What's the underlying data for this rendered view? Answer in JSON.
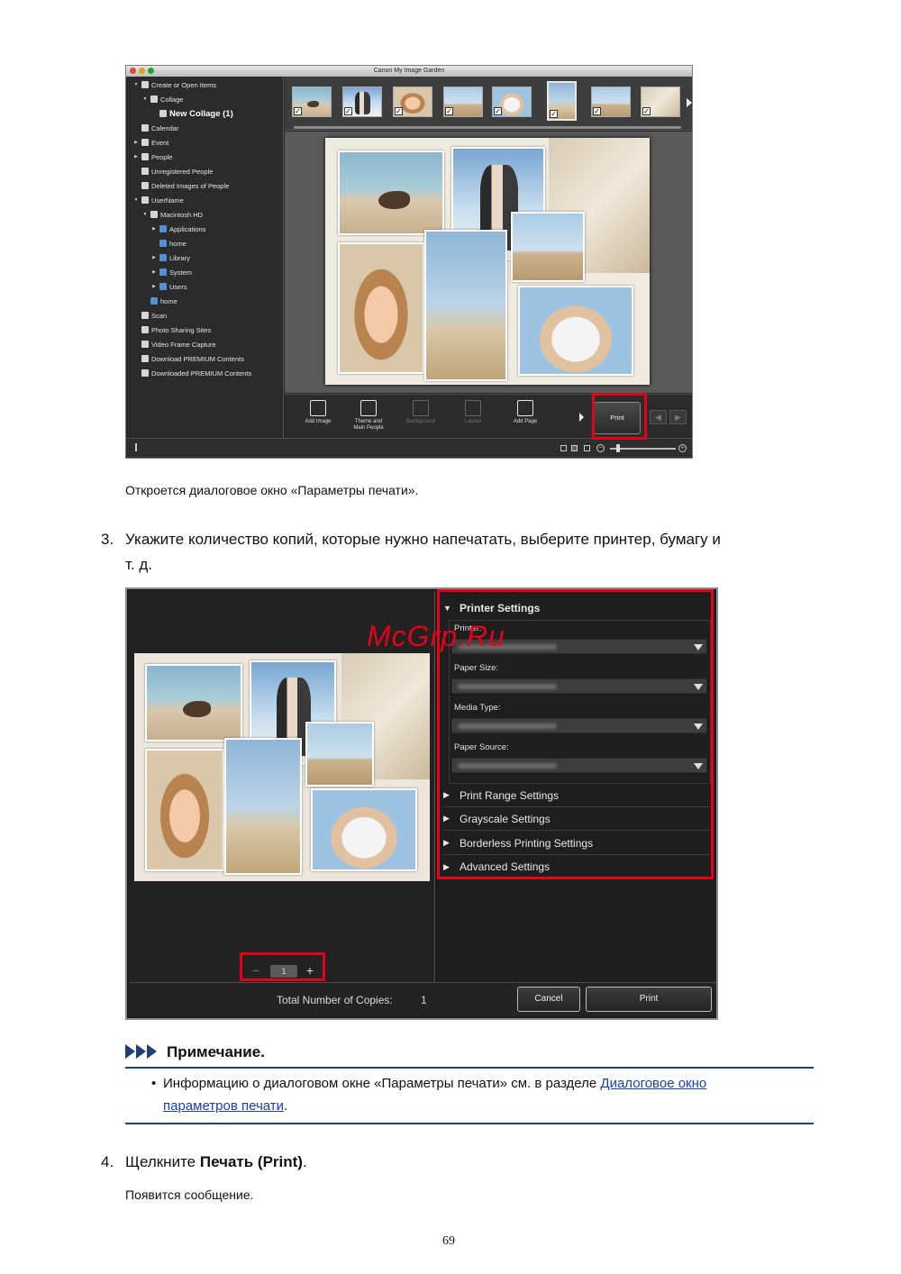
{
  "screenshot1": {
    "window_title": "Canon My Image Garden",
    "sidebar": [
      {
        "label": "Create or Open Items",
        "level": 0,
        "expanded": true,
        "icon": "create-icon"
      },
      {
        "label": "Collage",
        "level": 1,
        "expanded": true,
        "icon": "collage-icon"
      },
      {
        "label": "New Collage (1)",
        "level": 2,
        "selected": true,
        "icon": "collage-item-icon"
      },
      {
        "label": "Calendar",
        "level": 0,
        "icon": "calendar-icon"
      },
      {
        "label": "Event",
        "level": 0,
        "collapsed": true,
        "icon": "event-icon"
      },
      {
        "label": "People",
        "level": 0,
        "collapsed": true,
        "icon": "people-icon"
      },
      {
        "label": "Unregistered People",
        "level": 0,
        "icon": "person-icon"
      },
      {
        "label": "Deleted Images of People",
        "level": 0,
        "icon": "person-outline-icon"
      },
      {
        "label": "UserName",
        "level": 0,
        "expanded": true,
        "icon": "computer-icon"
      },
      {
        "label": "Macintosh HD",
        "level": 1,
        "expanded": true,
        "icon": "disk-icon"
      },
      {
        "label": "Applications",
        "level": 2,
        "collapsed": true,
        "icon": "folder-icon"
      },
      {
        "label": "home",
        "level": 2,
        "icon": "folder-icon"
      },
      {
        "label": "Library",
        "level": 2,
        "collapsed": true,
        "icon": "folder-icon"
      },
      {
        "label": "System",
        "level": 2,
        "collapsed": true,
        "icon": "folder-icon"
      },
      {
        "label": "Users",
        "level": 2,
        "collapsed": true,
        "icon": "folder-icon"
      },
      {
        "label": "home",
        "level": 1,
        "icon": "folder-icon"
      },
      {
        "label": "Scan",
        "level": 0,
        "icon": "scan-icon"
      },
      {
        "label": "Photo Sharing Sites",
        "level": 0,
        "icon": "share-icon"
      },
      {
        "label": "Video Frame Capture",
        "level": 0,
        "icon": "video-icon"
      },
      {
        "label": "Download PREMIUM Contents",
        "level": 0,
        "icon": "download-icon"
      },
      {
        "label": "Downloaded PREMIUM Contents",
        "level": 0,
        "icon": "downloaded-icon"
      }
    ],
    "toolbar": {
      "add_image": "Add Image",
      "theme_line1": "Theme and",
      "theme_line2": "Main People",
      "background": "Background",
      "layout": "Layout",
      "add_page": "Add Page",
      "print": "Print"
    }
  },
  "caption1": "Откроется диалоговое окно «Параметры печати».",
  "step3": {
    "number": "3.",
    "line1": "Укажите количество копий, которые нужно напечатать, выберите принтер, бумагу и",
    "line2": "т. д."
  },
  "screenshot2": {
    "watermark": "McGrp.Ru",
    "printer_settings": "Printer Settings",
    "fields": [
      {
        "label": "Printer:"
      },
      {
        "label": "Paper Size:"
      },
      {
        "label": "Media Type:"
      },
      {
        "label": "Paper Source:"
      }
    ],
    "sections": [
      "Print Range Settings",
      "Grayscale Settings",
      "Borderless Printing Settings",
      "Advanced Settings"
    ],
    "copies_value": "1",
    "stepper_minus": "−",
    "stepper_plus": "+",
    "total_copies_label": "Total Number of Copies:",
    "total_copies_value": "1",
    "cancel": "Cancel",
    "print": "Print"
  },
  "note": {
    "title": "Примечание.",
    "bullet": "•",
    "text_before": "Информацию о диалоговом окне «Параметры печати» см. в разделе ",
    "link_part1": "Диалоговое окно",
    "link_part2": "параметров печати",
    "text_after": "."
  },
  "step4": {
    "number": "4.",
    "text_before": "Щелкните ",
    "bold": "Печать (Print)",
    "text_after": "."
  },
  "caption2": "Появится сообщение.",
  "page_number": "69",
  "colors": {
    "highlight": "#e0001b",
    "note_accent": "#1f3e74",
    "link": "#1a3fb0"
  }
}
